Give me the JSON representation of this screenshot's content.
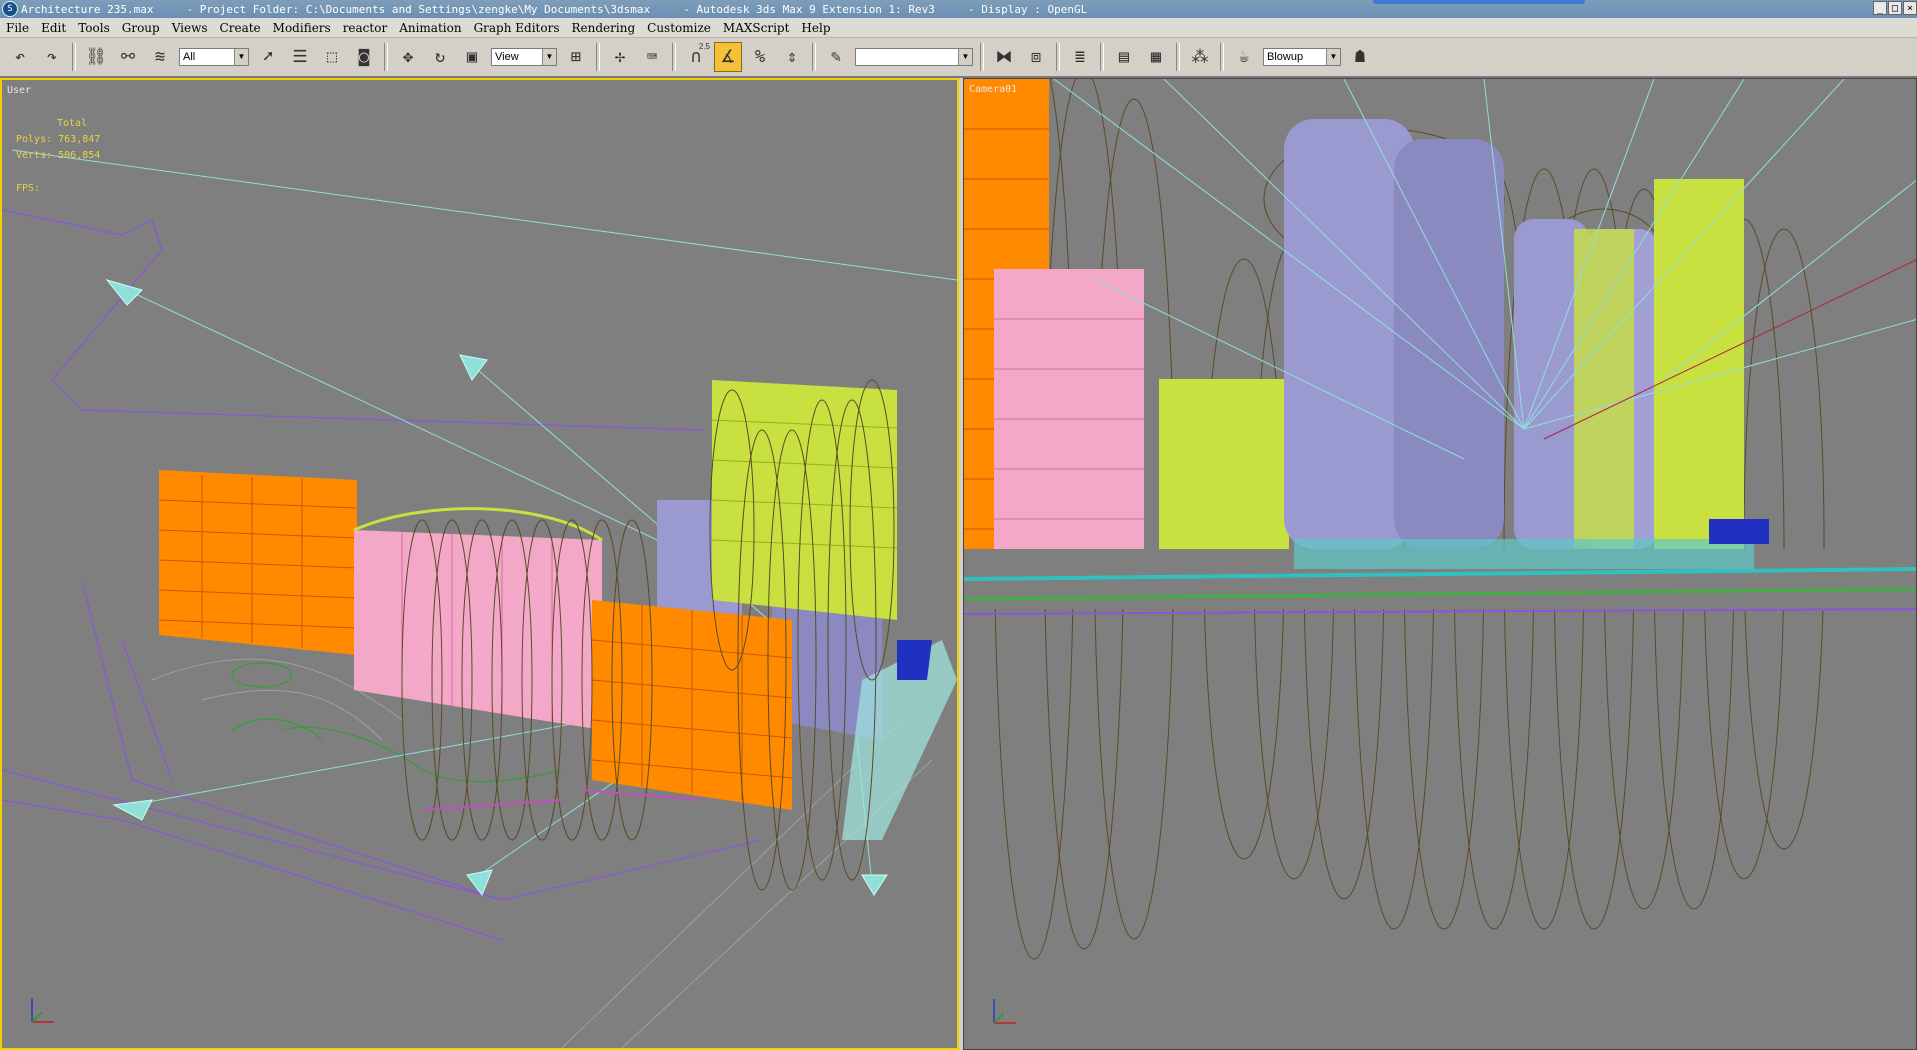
{
  "window": {
    "title": "Architecture 235.max     - Project Folder: C:\\Documents and Settings\\zengke\\My Documents\\3dsmax     - Autodesk 3ds Max 9 Extension 1: Rev3     - Display : OpenGL",
    "controls": [
      "_",
      "□",
      "×"
    ]
  },
  "menu": {
    "items": [
      "File",
      "Edit",
      "Tools",
      "Group",
      "Views",
      "Create",
      "Modifiers",
      "reactor",
      "Animation",
      "Graph Editors",
      "Rendering",
      "Customize",
      "MAXScript",
      "Help"
    ]
  },
  "toolbar": {
    "selection_filter": "All",
    "reference_coord": "View",
    "named_selection": "",
    "render_type": "Blowup",
    "snap_label": "2.5",
    "icons": [
      "undo-icon",
      "redo-icon",
      "select-link-icon",
      "unlink-icon",
      "bind-space-warp-icon",
      "select-object-icon",
      "select-by-name-icon",
      "rect-selection-icon",
      "window-crossing-icon",
      "move-icon",
      "rotate-icon",
      "scale-icon",
      "pivot-icon",
      "manipulate-icon",
      "keyboard-shortcut-icon",
      "snap-toggle-icon",
      "angle-snap-icon",
      "percent-snap-icon",
      "spinner-snap-icon",
      "edit-named-sel-icon",
      "mirror-icon",
      "align-icon",
      "layer-manager-icon",
      "curve-editor-icon",
      "schematic-icon",
      "material-editor-icon",
      "render-scene-icon",
      "quick-render-icon"
    ]
  },
  "viewports": {
    "left": {
      "label": "User",
      "stats_total": "Total",
      "polys": "Polys: 763,847",
      "verts": "Verts: 506,854",
      "fps": "FPS:"
    },
    "right": {
      "label": "Camera01"
    }
  },
  "colors": {
    "viewport_bg": "#7f7f7f",
    "active_border": "#f0d000",
    "stats_text": "#e8d24a",
    "building_orange": "#ff8a00",
    "building_pink": "#f4a8c8",
    "building_lime": "#c8e040",
    "building_lavender": "#9a9ad0",
    "wire_brown": "#5a4a28",
    "camera_cyan": "#8fe0d8"
  }
}
